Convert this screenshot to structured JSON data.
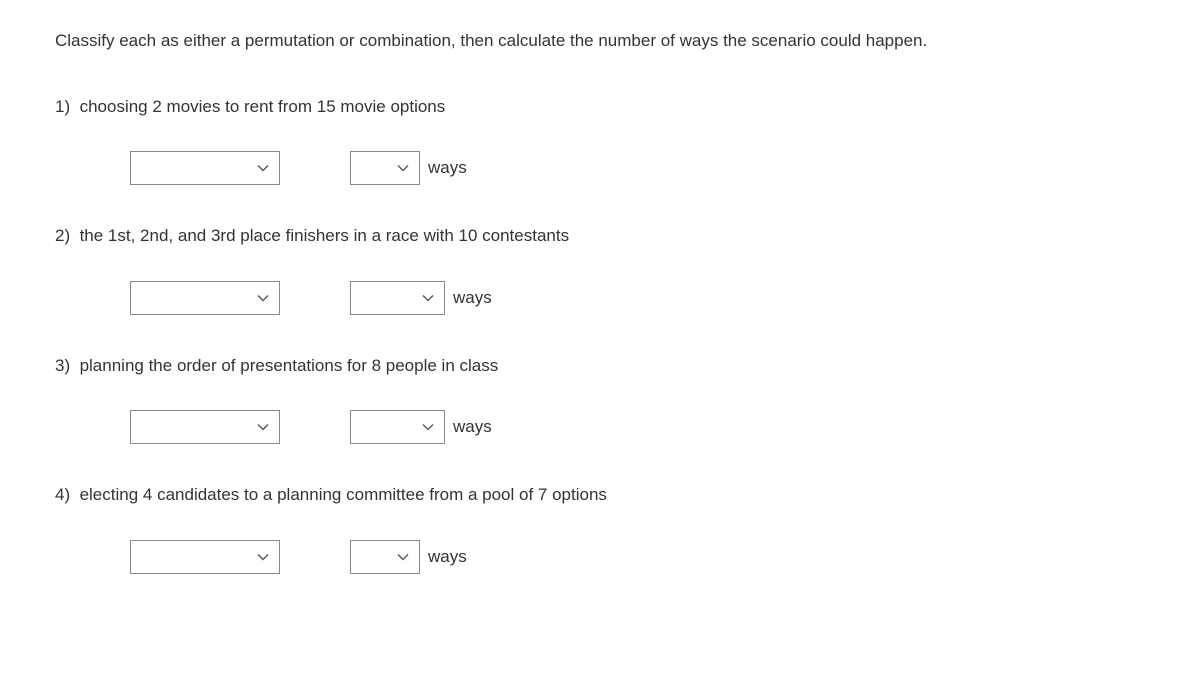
{
  "instruction": "Classify each as either a permutation or combination, then calculate the number of ways the scenario could happen.",
  "questions": [
    {
      "number": "1)",
      "text": "choosing 2 movies to rent from 15 movie options",
      "ways_label": "ways",
      "select2_width": "small"
    },
    {
      "number": "2)",
      "text": "the 1st, 2nd, and 3rd place finishers in a race with 10 contestants",
      "ways_label": "ways",
      "select2_width": "medium"
    },
    {
      "number": "3)",
      "text": "planning the order of presentations for 8 people in class",
      "ways_label": "ways",
      "select2_width": "medium"
    },
    {
      "number": "4)",
      "text": "electing 4 candidates to a planning committee from a pool of 7 options",
      "ways_label": "ways",
      "select2_width": "small"
    }
  ]
}
